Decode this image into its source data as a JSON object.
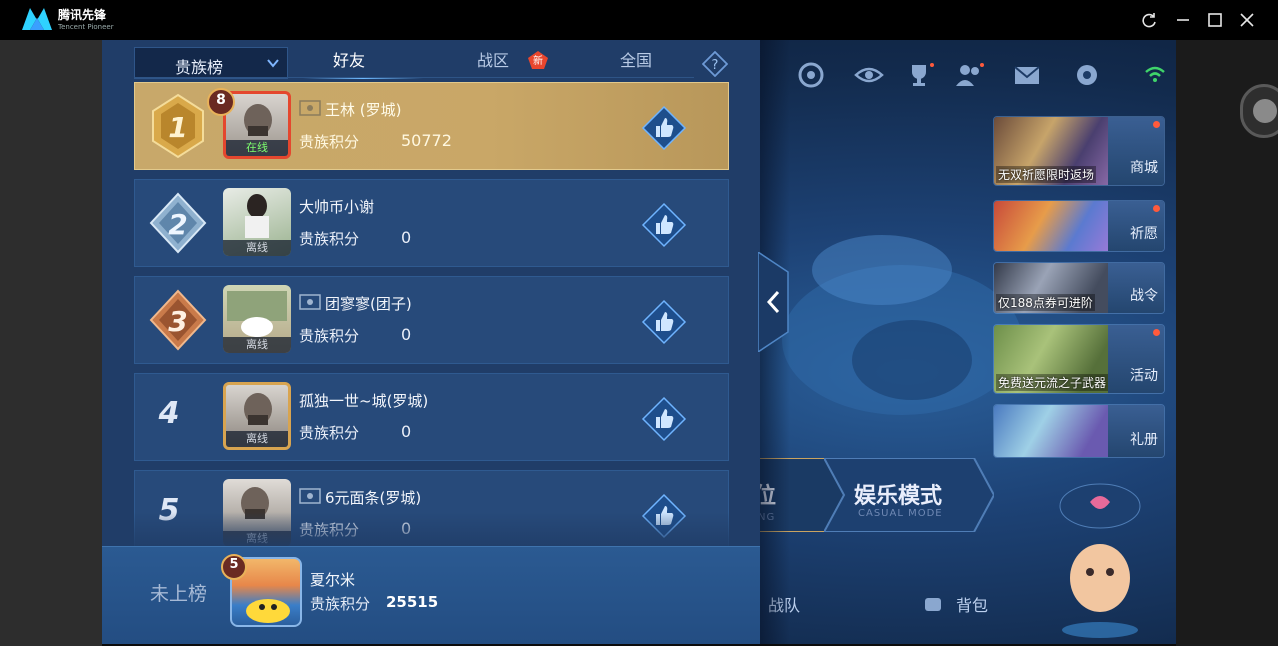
{
  "emulator": {
    "app_name": "腾讯先锋",
    "app_subtitle": "Tencent Pioneer",
    "window_controls": [
      "refresh-icon",
      "minimize-icon",
      "maximize-icon",
      "close-icon"
    ]
  },
  "leaderboard": {
    "dropdown_label": "贵族榜",
    "tabs": [
      {
        "label": "好友",
        "active": true
      },
      {
        "label": "战区",
        "active": false,
        "badge": "新"
      },
      {
        "label": "全国",
        "active": false
      }
    ],
    "score_label": "贵族积分",
    "entries": [
      {
        "rank": "1",
        "level": "8",
        "name": "王林 (罗城)",
        "score": "50772",
        "status": "在线",
        "has_icon": true
      },
      {
        "rank": "2",
        "level": "",
        "name": "大帅币小谢",
        "score": "0",
        "status": "离线",
        "has_icon": false
      },
      {
        "rank": "3",
        "level": "",
        "name": "团寥寥(团子)",
        "score": "0",
        "status": "离线",
        "has_icon": true
      },
      {
        "rank": "4",
        "level": "",
        "name": "孤独一世~城(罗城)",
        "score": "0",
        "status": "离线",
        "has_icon": false
      },
      {
        "rank": "5",
        "level": "",
        "name": "6元面条(罗城)",
        "score": "0",
        "status": "离线",
        "has_icon": true
      }
    ],
    "self": {
      "rank_label": "未上榜",
      "level": "5",
      "name": "夏尔米",
      "score_label": "贵族积分",
      "score": "25515"
    }
  },
  "lobby": {
    "shop_cards": [
      {
        "caption": "无双祈愿限时返场",
        "label": "商城"
      },
      {
        "caption": "",
        "label": "祈愿"
      },
      {
        "caption": "仅188点券可进阶",
        "label": "战令"
      },
      {
        "caption": "免费送元流之子武器",
        "label": "活动"
      },
      {
        "caption": "",
        "label": "礼册"
      }
    ],
    "mode_partial": "位",
    "mode_partial_sub": "NG",
    "mode_casual": "娱乐模式",
    "mode_casual_sub": "CASUAL MODE",
    "bottom_nav": [
      "战队",
      "背包"
    ]
  },
  "colors": {
    "panel_bg": "#203d68",
    "row_bg": "#274a7a",
    "gold_row": "#c9a767",
    "online_green": "#7dff6e",
    "new_badge_red": "#e8462e"
  }
}
